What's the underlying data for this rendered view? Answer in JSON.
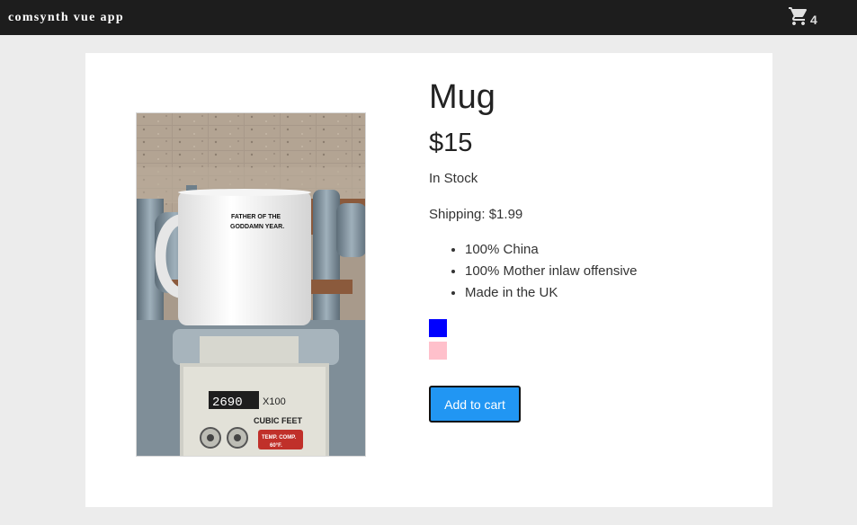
{
  "app": {
    "brand": "comsynth vue app"
  },
  "cart": {
    "count": "4",
    "icon": "shopping-cart-icon"
  },
  "product": {
    "title": "Mug",
    "price": "$15",
    "stock": "In Stock",
    "shipping": "Shipping: $1.99",
    "details": [
      "100% China",
      "100% Mother inlaw offensive",
      "Made in the UK"
    ],
    "variants": [
      {
        "color": "#0000ff"
      },
      {
        "color": "#ffc0cb"
      }
    ],
    "add_to_cart_label": "Add to cart",
    "image": {
      "mug_text_line1": "FATHER OF THE",
      "mug_text_line2": "GODDAMN YEAR.",
      "meter_counter": "2690",
      "meter_multiplier": "X100",
      "meter_unit": "CUBIC FEET",
      "meter_temp_line1": "TEMP. COMP.",
      "meter_temp_line2": "60°F."
    }
  },
  "colors": {
    "nav_bg": "#1d1d1d",
    "button": "#2196f3",
    "page_bg": "#ececec"
  }
}
